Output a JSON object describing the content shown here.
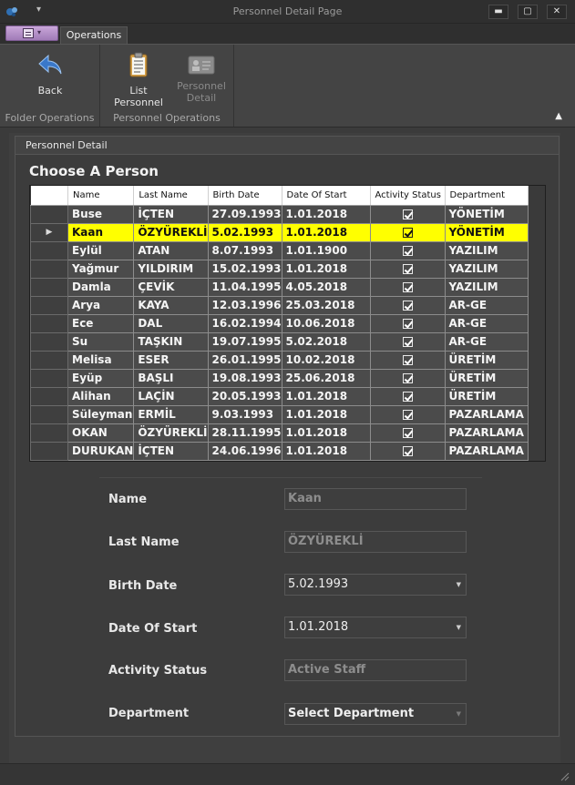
{
  "window": {
    "title": "Personnel Detail Page",
    "controls": {
      "minimize": "▬",
      "maximize": "▢",
      "close": "✕"
    }
  },
  "ribbon": {
    "tab": "Operations",
    "groups": [
      {
        "label": "Folder Operations",
        "buttons": [
          {
            "label": "Back",
            "icon": "back-arrow-icon",
            "enabled": true
          }
        ]
      },
      {
        "label": "Personnel Operations",
        "buttons": [
          {
            "label": "List Personnel",
            "icon": "clipboard-list-icon",
            "enabled": true
          },
          {
            "label_line1": "Personnel",
            "label_line2": "Detail",
            "icon": "id-card-icon",
            "enabled": false
          }
        ]
      }
    ]
  },
  "panel": {
    "header": "Personnel Detail",
    "title": "Choose A Person"
  },
  "grid": {
    "columns": [
      "Name",
      "Last Name",
      "Birth Date",
      "Date Of Start",
      "Activity Status",
      "Department"
    ],
    "selected_index": 1,
    "rows": [
      [
        "Buse",
        "İÇTEN",
        "27.09.1993",
        "1.01.2018",
        true,
        "YÖNETİM"
      ],
      [
        "Kaan",
        "ÖZYÜREKLİ",
        "5.02.1993",
        "1.01.2018",
        true,
        "YÖNETİM"
      ],
      [
        "Eylül",
        "ATAN",
        "8.07.1993",
        "1.01.1900",
        true,
        "YAZILIM"
      ],
      [
        "Yağmur",
        "YILDIRIM",
        "15.02.1993",
        "1.01.2018",
        true,
        "YAZILIM"
      ],
      [
        "Damla",
        "ÇEVİK",
        "11.04.1995",
        "4.05.2018",
        true,
        "YAZILIM"
      ],
      [
        "Arya",
        "KAYA",
        "12.03.1996",
        "25.03.2018",
        true,
        "AR-GE"
      ],
      [
        "Ece",
        "DAL",
        "16.02.1994",
        "10.06.2018",
        true,
        "AR-GE"
      ],
      [
        "Su",
        "TAŞKIN",
        "19.07.1995",
        "5.02.2018",
        true,
        "AR-GE"
      ],
      [
        "Melisa",
        "ESER",
        "26.01.1995",
        "10.02.2018",
        true,
        "ÜRETİM"
      ],
      [
        "Eyüp",
        "BAŞLI",
        "19.08.1993",
        "25.06.2018",
        true,
        "ÜRETİM"
      ],
      [
        "Alihan",
        "LAÇİN",
        "20.05.1993",
        "1.01.2018",
        true,
        "ÜRETİM"
      ],
      [
        "Süleyman",
        "ERMİL",
        "9.03.1993",
        "1.01.2018",
        true,
        "PAZARLAMA"
      ],
      [
        "OKAN",
        "ÖZYÜREKLİ",
        "28.11.1995",
        "1.01.2018",
        true,
        "PAZARLAMA"
      ],
      [
        "DURUKAN",
        "İÇTEN",
        "24.06.1996",
        "1.01.2018",
        true,
        "PAZARLAMA"
      ]
    ]
  },
  "form": {
    "name": {
      "label": "Name",
      "value": "Kaan"
    },
    "last_name": {
      "label": "Last Name",
      "value": "ÖZYÜREKLİ"
    },
    "birth_date": {
      "label": "Birth Date",
      "value": "5.02.1993"
    },
    "date_of_start": {
      "label": "Date Of Start",
      "value": "1.01.2018"
    },
    "activity_status": {
      "label": "Activity Status",
      "value": "Active Staff"
    },
    "department": {
      "label": "Department",
      "value": "Select Department"
    }
  },
  "colors": {
    "selected_row": "#ffff00",
    "background": "#3b3b3b",
    "back_icon": "#3a78c9"
  }
}
